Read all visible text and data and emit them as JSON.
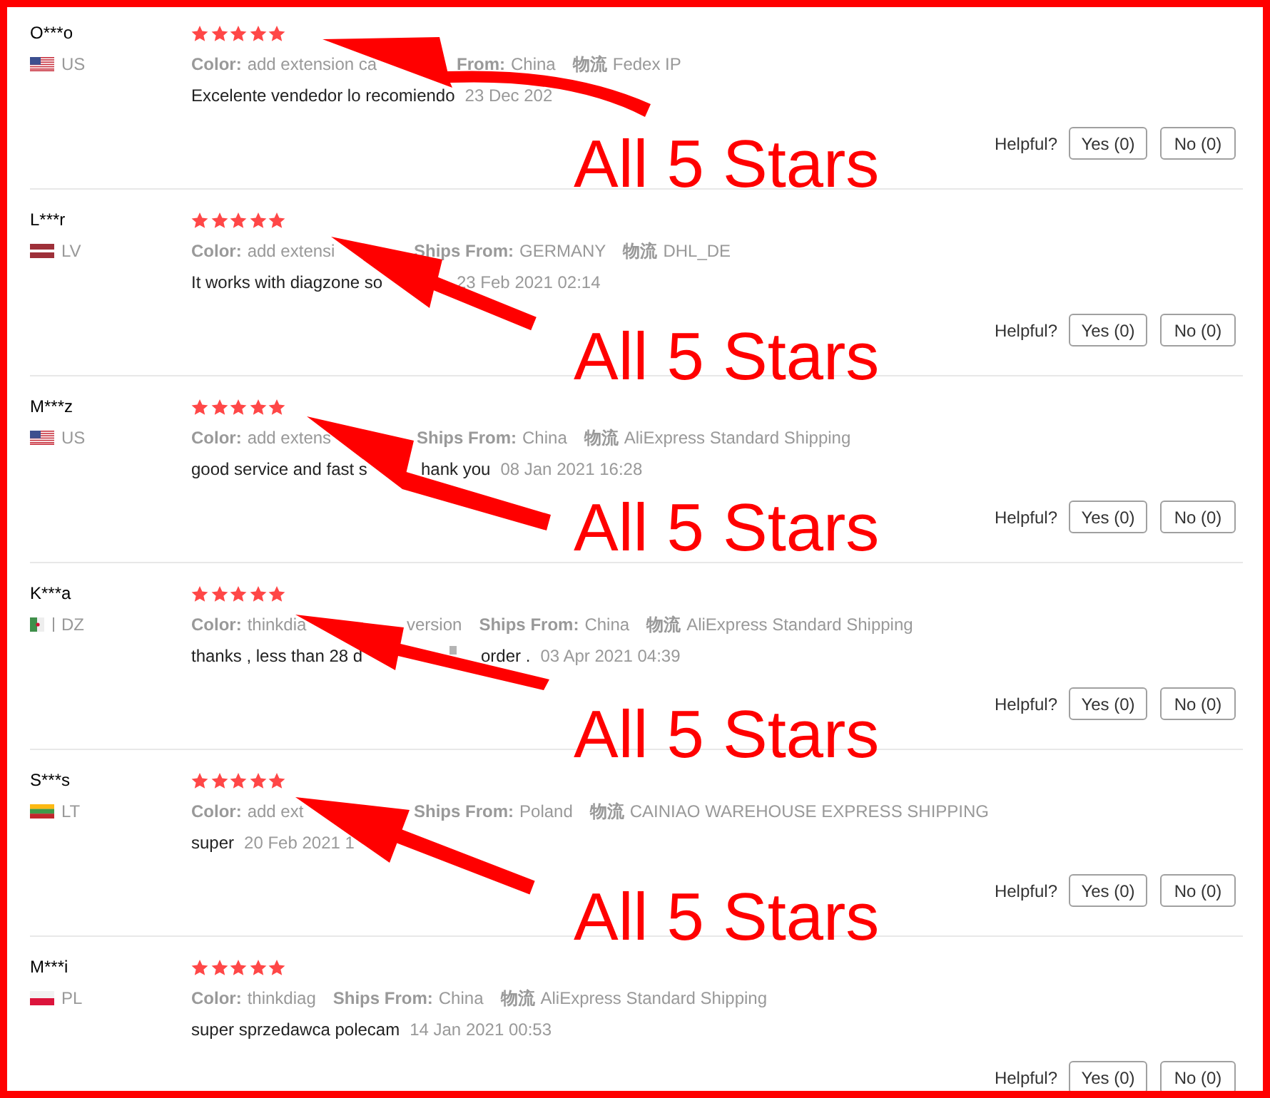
{
  "reviews": [
    {
      "reviewer": "O***o",
      "country": "US",
      "stars": 5,
      "attributes": [
        {
          "label": "Color:",
          "value": "add extension ca"
        },
        {
          "label": "From:",
          "value": "China"
        },
        {
          "label": "物流",
          "value": "Fedex IP"
        }
      ],
      "comment": [
        {
          "kind": "text",
          "text": "Excelente vendedor lo recomiendo"
        }
      ],
      "date": "23 Dec 202",
      "helpful_label": "Helpful?",
      "buttons": [
        "Yes (0)",
        "No (0)"
      ],
      "annotation": "All 5 Stars"
    },
    {
      "reviewer": "L***r",
      "country": "LV",
      "stars": 5,
      "attributes": [
        {
          "label": "Color:",
          "value": "add extensi"
        },
        {
          "label": "Ships From:",
          "value": "GERMANY"
        },
        {
          "label": "物流",
          "value": "DHL_DE"
        }
      ],
      "comment": [
        {
          "kind": "text",
          "text": "It works with diagzone so"
        }
      ],
      "date": "23 Feb 2021 02:14",
      "helpful_label": "Helpful?",
      "buttons": [
        "Yes (0)",
        "No (0)"
      ],
      "annotation": "All 5 Stars"
    },
    {
      "reviewer": "M***z",
      "country": "US",
      "stars": 5,
      "attributes": [
        {
          "label": "Color:",
          "value": "add extens"
        },
        {
          "label": "Ships From:",
          "value": "China"
        },
        {
          "label": "物流",
          "value": "AliExpress Standard Shipping"
        }
      ],
      "comment": [
        {
          "kind": "text",
          "text": "good service and fast s"
        },
        {
          "kind": "text",
          "text": "hank you"
        }
      ],
      "date": "08 Jan 2021 16:28",
      "helpful_label": "Helpful?",
      "buttons": [
        "Yes (0)",
        "No (0)"
      ],
      "annotation": "All 5 Stars"
    },
    {
      "reviewer": "K***a",
      "country": "DZ",
      "stars": 5,
      "attributes": [
        {
          "label": "Color:",
          "value": "thinkdia"
        },
        {
          "value": "version"
        },
        {
          "label": "Ships From:",
          "value": "China"
        },
        {
          "label": "物流",
          "value": "AliExpress Standard Shipping"
        }
      ],
      "comment": [
        {
          "kind": "text",
          "text": "thanks , less than 28 d"
        },
        {
          "kind": "glyph"
        },
        {
          "kind": "text",
          "text": "order ."
        }
      ],
      "date": "03 Apr 2021 04:39",
      "helpful_label": "Helpful?",
      "buttons": [
        "Yes (0)",
        "No (0)"
      ],
      "annotation": "All 5 Stars"
    },
    {
      "reviewer": "S***s",
      "country": "LT",
      "stars": 5,
      "attributes": [
        {
          "label": "Color:",
          "value": "add ext"
        },
        {
          "label": "Ships From:",
          "value": "Poland"
        },
        {
          "label": "物流",
          "value": "CAINIAO WAREHOUSE EXPRESS SHIPPING"
        }
      ],
      "comment": [
        {
          "kind": "text",
          "text": "super"
        }
      ],
      "date": "20 Feb 2021 1",
      "helpful_label": "Helpful?",
      "buttons": [
        "Yes (0)",
        "No (0)"
      ],
      "annotation": "All 5 Stars"
    },
    {
      "reviewer": "M***i",
      "country": "PL",
      "stars": 5,
      "attributes": [
        {
          "label": "Color:",
          "value": "thinkdiag"
        },
        {
          "label": "Ships From:",
          "value": "China"
        },
        {
          "label": "物流",
          "value": "AliExpress Standard Shipping"
        }
      ],
      "comment": [
        {
          "kind": "text",
          "text": "super sprzedawca polecam"
        }
      ],
      "date": "14 Jan 2021 00:53",
      "helpful_label": "Helpful?",
      "buttons": [
        "Yes (0)",
        "No (0)"
      ]
    }
  ]
}
